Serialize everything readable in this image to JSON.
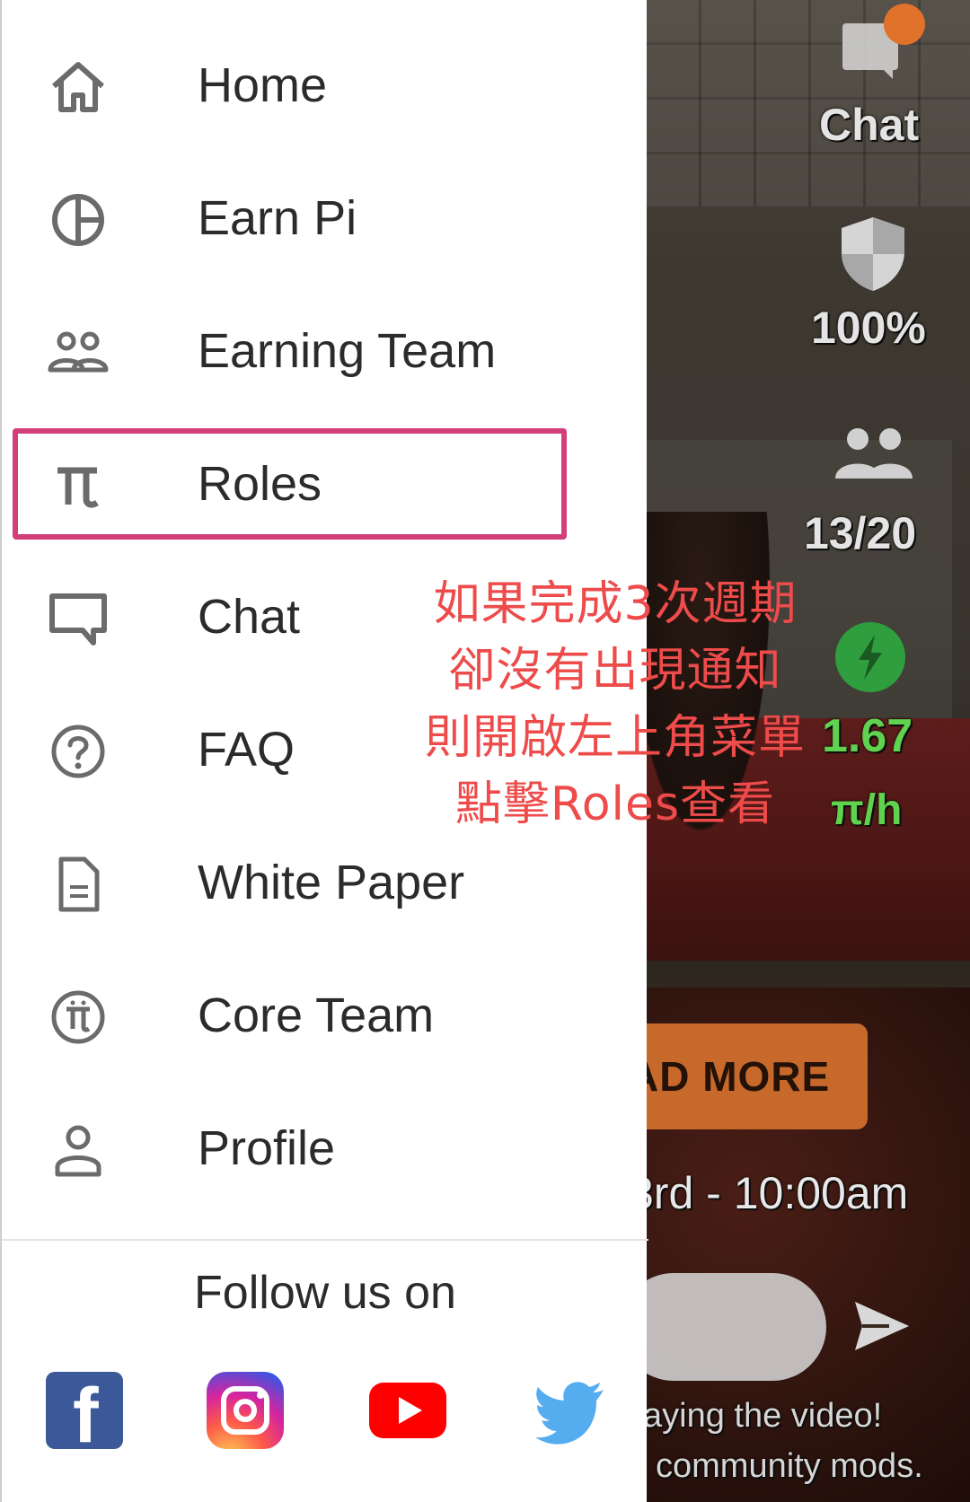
{
  "drawer": {
    "items": [
      {
        "label": "Home",
        "icon": "home-icon"
      },
      {
        "label": "Earn Pi",
        "icon": "pie-chart-icon"
      },
      {
        "label": "Earning Team",
        "icon": "team-icon"
      },
      {
        "label": "Roles",
        "icon": "pi-symbol-icon"
      },
      {
        "label": "Chat",
        "icon": "chat-icon"
      },
      {
        "label": "FAQ",
        "icon": "question-icon"
      },
      {
        "label": "White Paper",
        "icon": "document-icon"
      },
      {
        "label": "Core Team",
        "icon": "pi-coin-icon"
      },
      {
        "label": "Profile",
        "icon": "profile-icon"
      }
    ],
    "highlighted_item": "Roles",
    "highlight_color": "#d23f7a",
    "follow_label": "Follow us on",
    "social": [
      "facebook-icon",
      "instagram-icon",
      "youtube-icon",
      "twitter-icon"
    ]
  },
  "annotation": {
    "lines": [
      "如果完成3次週期",
      "卻沒有出現通知",
      "則開啟左上角菜單",
      "點擊Roles查看"
    ],
    "color": "#ee4b4b"
  },
  "background": {
    "chat_label": "Chat",
    "security_percent": "100%",
    "team_count": "13/20",
    "mining_rate": "1.67",
    "rate_unit": "π/h",
    "read_more_label": "AD MORE",
    "event_time": "3rd - 10:00am",
    "message_line1": "aying the video!",
    "message_line2": "community mods."
  }
}
